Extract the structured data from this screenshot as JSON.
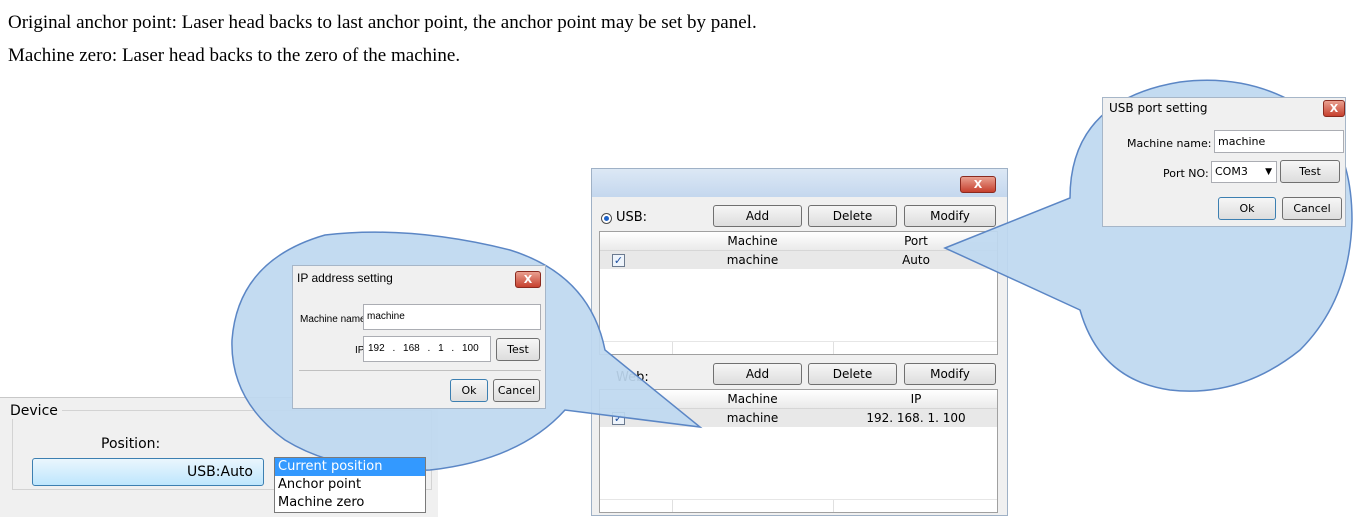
{
  "doc": {
    "line1": "Original anchor point: Laser head backs to last anchor point, the anchor point may be set by panel.",
    "line2": "Machine zero: Laser head backs to the zero of the machine."
  },
  "device_panel": {
    "group_label": "Device",
    "position_label": "Position:",
    "device_button": "USB:Auto",
    "position_options": [
      "Current position",
      "Anchor point",
      "Machine zero"
    ]
  },
  "ip_dialog": {
    "title": "IP address setting",
    "close": "X",
    "machine_name_label": "Machine name:",
    "machine_name_value": "machine",
    "ip_label": "IP",
    "ip_octets": [
      "192",
      "168",
      "1",
      "100"
    ],
    "test_button": "Test",
    "ok_button": "Ok",
    "cancel_button": "Cancel"
  },
  "usb_dialog": {
    "title": "USB port setting",
    "close": "X",
    "machine_name_label": "Machine name:",
    "machine_name_value": "machine",
    "port_label": "Port NO:",
    "port_value": "COM3",
    "test_button": "Test",
    "ok_button": "Ok",
    "cancel_button": "Cancel"
  },
  "main_window": {
    "close": "X",
    "usb_section": {
      "label": "USB:",
      "add": "Add",
      "delete": "Delete",
      "modify": "Modify",
      "columns": [
        "Machine",
        "Port"
      ],
      "rows": [
        {
          "checked": true,
          "machine": "machine",
          "value": "Auto"
        }
      ]
    },
    "web_section": {
      "label": "Web:",
      "add": "Add",
      "delete": "Delete",
      "modify": "Modify",
      "columns": [
        "Machine",
        "IP"
      ],
      "rows": [
        {
          "checked": true,
          "machine": "machine",
          "value": "192. 168. 1. 100"
        }
      ]
    }
  },
  "colors": {
    "bubble_fill": "#bed8f0",
    "bubble_stroke": "#5b86c5",
    "selection": "#3399ff"
  }
}
